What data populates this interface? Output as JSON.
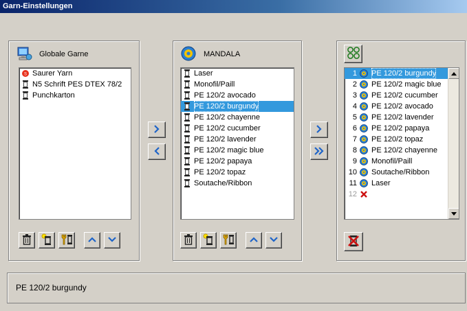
{
  "window": {
    "title": "Garn-Einstellungen"
  },
  "left_panel": {
    "title": "Globale Garne",
    "items": [
      {
        "label": "Saurer Yarn",
        "icon": "saurer-logo-icon"
      },
      {
        "label": "N5 Schrift PES DTEX 78/2",
        "icon": "spool-icon"
      },
      {
        "label": "Punchkarton",
        "icon": "spool-icon"
      }
    ]
  },
  "middle_panel": {
    "title": "MANDALA",
    "selected_index": 3,
    "items": [
      {
        "label": "Laser"
      },
      {
        "label": "Monofil/Paill"
      },
      {
        "label": "PE 120/2 avocado"
      },
      {
        "label": "PE 120/2 burgundy"
      },
      {
        "label": "PE 120/2 chayenne"
      },
      {
        "label": "PE 120/2 cucumber"
      },
      {
        "label": "PE 120/2 lavender"
      },
      {
        "label": "PE 120/2 magic blue"
      },
      {
        "label": "PE 120/2 papaya"
      },
      {
        "label": "PE 120/2 topaz"
      },
      {
        "label": "Soutache/Ribbon"
      }
    ]
  },
  "right_panel": {
    "selected_index": 0,
    "items": [
      {
        "num": "1",
        "label": "PE 120/2 burgundy"
      },
      {
        "num": "2",
        "label": "PE 120/2 magic blue"
      },
      {
        "num": "3",
        "label": "PE 120/2 cucumber"
      },
      {
        "num": "4",
        "label": "PE 120/2 avocado"
      },
      {
        "num": "5",
        "label": "PE 120/2 lavender"
      },
      {
        "num": "6",
        "label": "PE 120/2 papaya"
      },
      {
        "num": "7",
        "label": "PE 120/2 topaz"
      },
      {
        "num": "8",
        "label": "PE 120/2 chayenne"
      },
      {
        "num": "9",
        "label": "Monofil/Paill"
      },
      {
        "num": "10",
        "label": "Soutache/Ribbon"
      },
      {
        "num": "11",
        "label": "Laser"
      },
      {
        "num": "12",
        "label": ""
      }
    ]
  },
  "status": {
    "text": "PE 120/2 burgundy"
  },
  "colors": {
    "selection": "#3399dd",
    "panel_bg": "#d4d0c8",
    "delete_red": "#cc1111"
  }
}
